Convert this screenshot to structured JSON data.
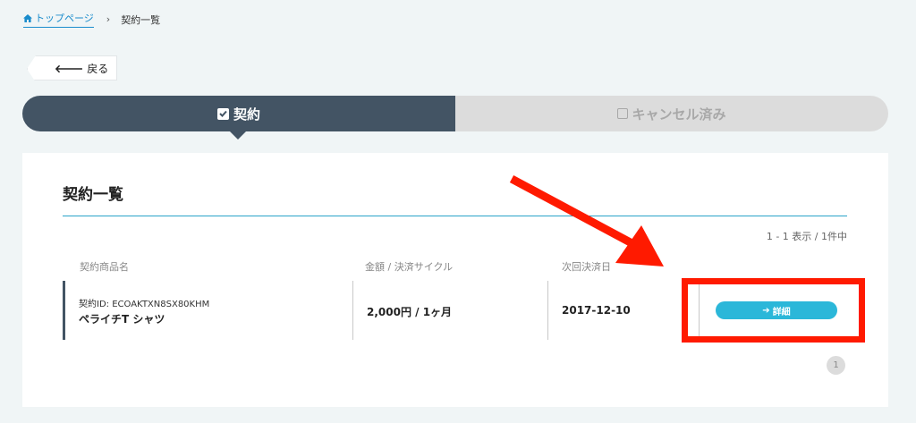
{
  "breadcrumb": {
    "home": "トップページ",
    "separator": "›",
    "current": "契約一覧"
  },
  "back_label": "戻る",
  "tabs": [
    {
      "label": "契約",
      "active": true
    },
    {
      "label": "キャンセル済み",
      "active": false
    }
  ],
  "panel": {
    "title": "契約一覧",
    "count_text": "1 - 1 表示 / 1件中",
    "columns": [
      "契約商品名",
      "金額 / 決済サイクル",
      "次回決済日"
    ],
    "rows": [
      {
        "contract_id": "契約ID: ECOAKTXN8SX80KHM",
        "product_name": "ペライチT シャツ",
        "price": "2,000円 / 1ヶ月",
        "next_date": "2017-12-10",
        "action_label": "詳細"
      }
    ],
    "page": "1"
  },
  "colors": {
    "accent": "#2bb7d9",
    "tab_active": "#435464",
    "annotation": "#ff1a00"
  }
}
